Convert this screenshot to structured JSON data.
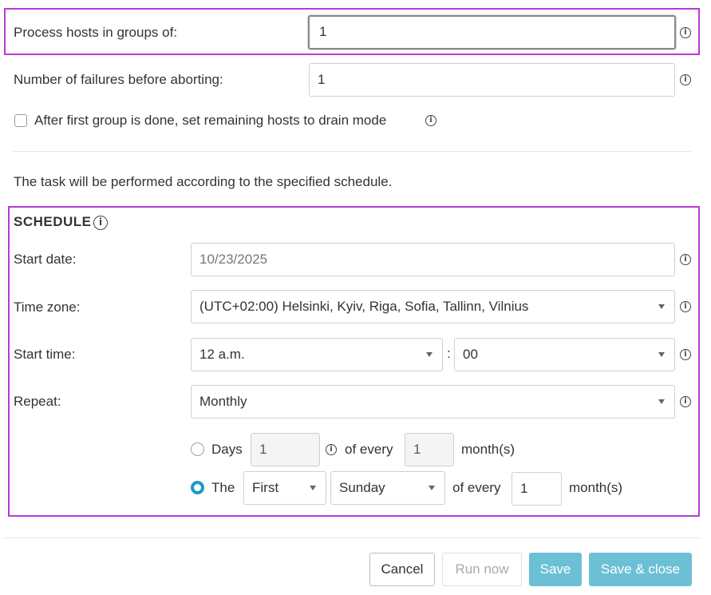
{
  "group": {
    "process_label": "Process hosts in groups of:",
    "process_value": "1",
    "failures_label": "Number of failures before aborting:",
    "failures_value": "1",
    "drain_label": "After first group is done, set remaining hosts to drain mode"
  },
  "schedule_note": "The task will be performed according to the specified schedule.",
  "schedule": {
    "title": "SCHEDULE",
    "start_date_label": "Start date:",
    "start_date_value": "10/23/2025",
    "timezone_label": "Time zone:",
    "timezone_value": "(UTC+02:00) Helsinki, Kyiv, Riga, Sofia, Tallinn, Vilnius",
    "start_time_label": "Start time:",
    "start_time_hour": "12 a.m.",
    "time_separator": ":",
    "start_time_minute": "00",
    "repeat_label": "Repeat:",
    "repeat_value": "Monthly",
    "days_label": "Days",
    "days_value": "1",
    "of_every_1": "of every",
    "days_months_value": "1",
    "months_1": "month(s)",
    "the_label": "The",
    "ordinal_value": "First",
    "weekday_value": "Sunday",
    "of_every_2": "of every",
    "the_months_value": "1",
    "months_2": "month(s)"
  },
  "buttons": {
    "cancel": "Cancel",
    "run_now": "Run now",
    "save": "Save",
    "save_close": "Save & close"
  },
  "icons": {
    "info": "info-icon",
    "caret": "chevron-down-icon"
  },
  "colors": {
    "highlight": "#b63ad6",
    "primary": "#6cc0d6",
    "radio_checked": "#1a9cc7"
  }
}
